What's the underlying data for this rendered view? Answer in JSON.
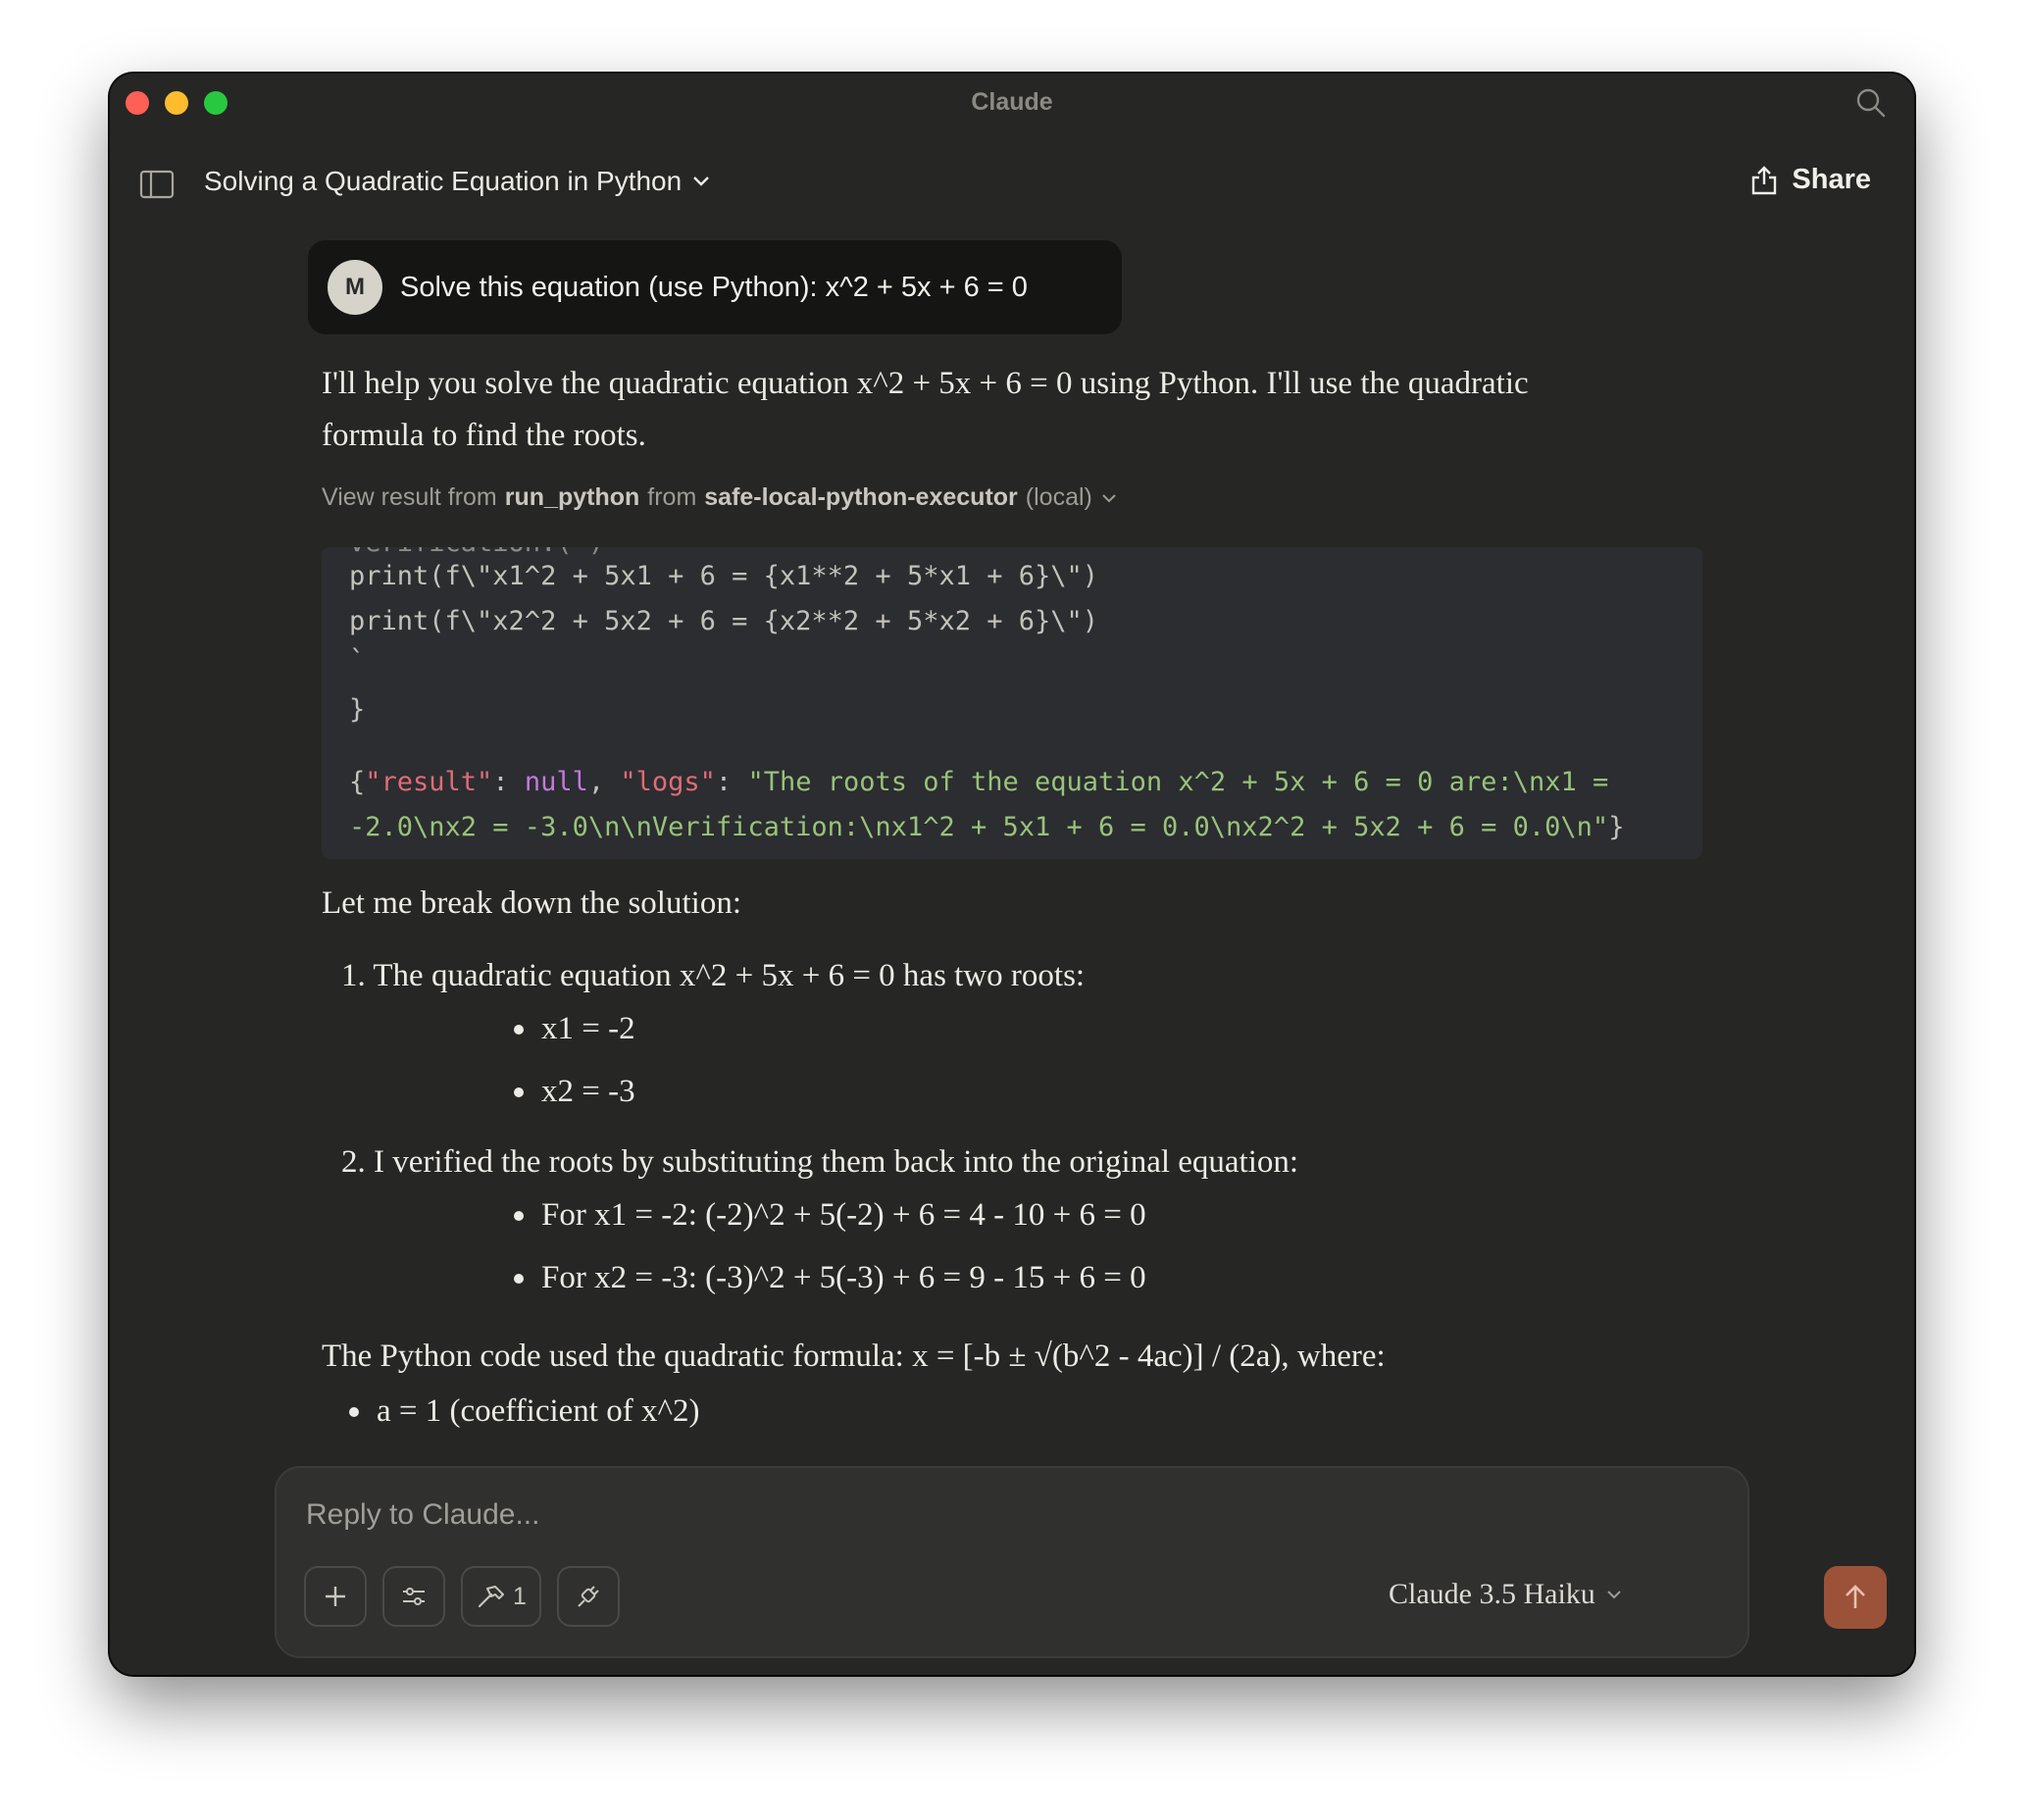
{
  "window": {
    "title": "Claude"
  },
  "header": {
    "conversation_title": "Solving a Quadratic Equation in Python",
    "share_label": "Share"
  },
  "user_message": {
    "avatar_initial": "M",
    "text": "Solve this equation (use Python): x^2 + 5x + 6 = 0"
  },
  "assistant": {
    "intro_line1": "I'll help you solve the quadratic equation x^2 + 5x + 6 = 0 using Python. I'll use the quadratic",
    "intro_line2": "formula to find the roots.",
    "tool_result": {
      "prefix": "View result from",
      "tool": "run_python",
      "mid": "from",
      "server": "safe-local-python-executor",
      "suffix": "(local)"
    },
    "code_lines": {
      "cut": "verification:(\")",
      "l1": "print(f\\\"x1^2 + 5x1 + 6 = {x1**2 + 5*x1 + 6}\\\")",
      "l2": "print(f\\\"x2^2 + 5x2 + 6 = {x2**2 + 5*x2 + 6}\\\")",
      "l3": "`",
      "l4": "}"
    },
    "json_result": {
      "open": "{",
      "result_key": "\"result\"",
      "colon1": ": ",
      "null_val": "null",
      "comma": ", ",
      "logs_key": "\"logs\"",
      "colon2": ": ",
      "logs_val_line1": "\"The roots of the equation x^2 + 5x + 6 = 0 are:\\nx1 =",
      "logs_val_line2": "-2.0\\nx2 = -3.0\\n\\nVerification:\\nx1^2 + 5x1 + 6 = 0.0\\nx2^2 + 5x2 + 6 = 0.0\\n\"",
      "close": "}"
    },
    "breakdown_intro": "Let me break down the solution:",
    "item1": "1. The quadratic equation x^2 + 5x + 6 = 0 has two roots:",
    "item1_bullets": [
      "x1 = -2",
      "x2 = -3"
    ],
    "item2": "2. I verified the roots by substituting them back into the original equation:",
    "item2_bullets": [
      "For x1 = -2: (-2)^2 + 5(-2) + 6 = 4 - 10 + 6 = 0",
      "For x2 = -3: (-3)^2 + 5(-3) + 6 = 9 - 15 + 6 = 0"
    ],
    "formula_line": "The Python code used the quadratic formula: x = [-b ± √(b^2 - 4ac)] / (2a), where:",
    "coef_bullets": [
      "a = 1 (coefficient of x^2)"
    ]
  },
  "composer": {
    "placeholder": "Reply to Claude...",
    "tools_count": "1",
    "model": "Claude 3.5 Haiku"
  },
  "colors": {
    "send_button": "#9b5238",
    "background": "#262624"
  }
}
